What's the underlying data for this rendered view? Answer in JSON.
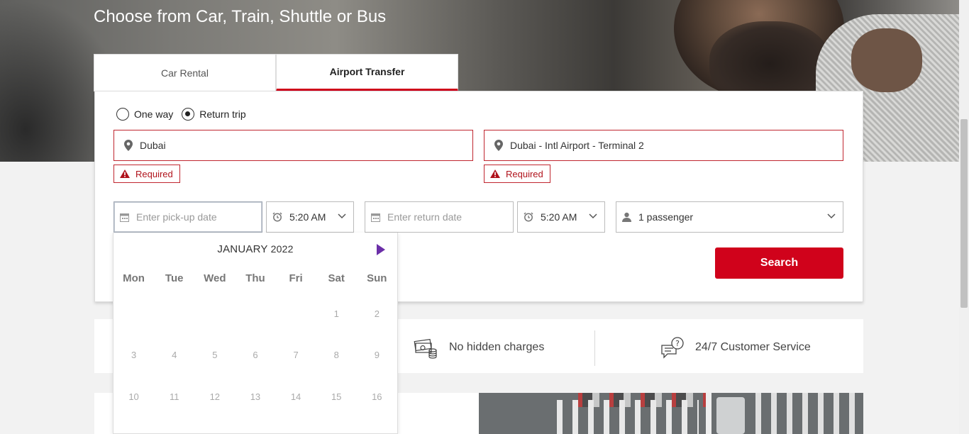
{
  "hero": {
    "subtitle": "Choose from Car, Train, Shuttle or Bus"
  },
  "tabs": [
    {
      "label": "Car Rental",
      "active": false
    },
    {
      "label": "Airport Transfer",
      "active": true
    }
  ],
  "trip_type": {
    "options": [
      {
        "label": "One way",
        "checked": false
      },
      {
        "label": "Return trip",
        "checked": true
      }
    ]
  },
  "from": {
    "value": "Dubai",
    "error": "Required"
  },
  "to": {
    "value": "Dubai - Intl Airport - Terminal 2",
    "error": "Required"
  },
  "pickup": {
    "date_placeholder": "Enter pick-up date",
    "time": "5:20 AM"
  },
  "return_trip": {
    "date_placeholder": "Enter return date",
    "time": "5:20 AM"
  },
  "passengers": {
    "value": "1 passenger"
  },
  "search": {
    "label": "Search"
  },
  "features": [
    {
      "label": "No hidden charges",
      "icon": "cash-icon"
    },
    {
      "label": "24/7 Customer Service",
      "icon": "support-chat-icon"
    }
  ],
  "calendar": {
    "month": "JANUARY",
    "year": "2022",
    "weekdays": [
      "Mon",
      "Tue",
      "Wed",
      "Thu",
      "Fri",
      "Sat",
      "Sun"
    ],
    "weeks": [
      [
        "",
        "",
        "",
        "",
        "",
        "1",
        "2"
      ],
      [
        "3",
        "4",
        "5",
        "6",
        "7",
        "8",
        "9"
      ],
      [
        "10",
        "11",
        "12",
        "13",
        "14",
        "15",
        "16"
      ]
    ]
  },
  "colors": {
    "accent": "#d0021b",
    "error": "#c0262f",
    "calendar_arrow": "#6b2fa8"
  }
}
